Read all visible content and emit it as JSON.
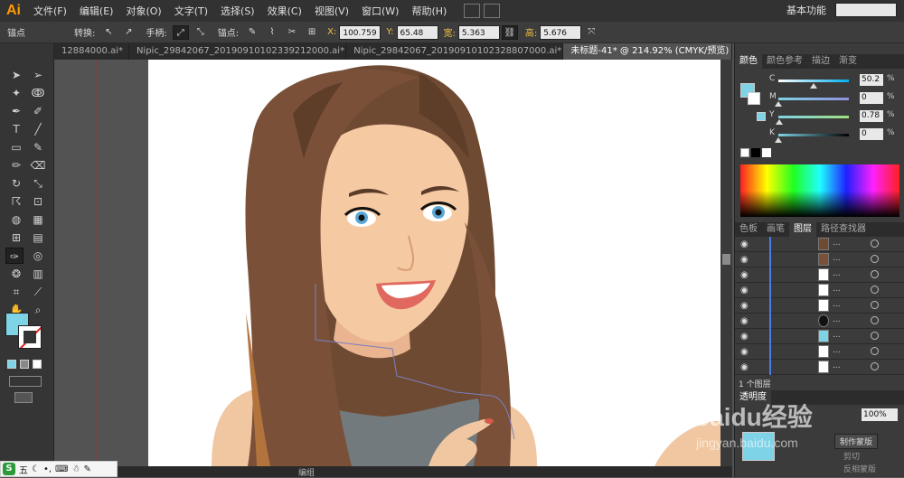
{
  "app": {
    "logo": "Ai"
  },
  "menubar": {
    "items": [
      "文件(F)",
      "编辑(E)",
      "对象(O)",
      "文字(T)",
      "选择(S)",
      "效果(C)",
      "视图(V)",
      "窗口(W)",
      "帮助(H)"
    ],
    "workspace": "基本功能"
  },
  "controlbar": {
    "mode_label": "锚点",
    "convert_label": "转换:",
    "handle_label": "手柄:",
    "anchor_label": "锚点:",
    "x_label": "X:",
    "x_value": "100.759",
    "y_label": "Y:",
    "y_value": "65.48 mm",
    "w_label": "宽:",
    "w_value": "5.363 mm",
    "h_label": "高:",
    "h_value": "5.676 mm"
  },
  "tabs": [
    {
      "label": "12884000.ai*",
      "active": false
    },
    {
      "label": "Nipic_29842067_20190910102339212000.ai*",
      "active": false
    },
    {
      "label": "Nipic_29842067_20190910102328807000.ai*",
      "active": false
    },
    {
      "label": "未标题-41* @ 214.92% (CMYK/预览)",
      "active": true
    }
  ],
  "color_panel": {
    "tabs": [
      "颜色",
      "颜色参考",
      "描边",
      "渐变"
    ],
    "channels": [
      {
        "name": "C",
        "value": "50.2",
        "unit": "%",
        "level": 0.502
      },
      {
        "name": "M",
        "value": "0",
        "unit": "%",
        "level": 0
      },
      {
        "name": "Y",
        "value": "0.78",
        "unit": "%",
        "level": 0.0078
      },
      {
        "name": "K",
        "value": "0",
        "unit": "%",
        "level": 0
      }
    ],
    "fill_color": "#7fd3e6"
  },
  "layers_panel": {
    "tabs": [
      "色板",
      "画笔",
      "图层",
      "路径查找器"
    ],
    "rows": [
      "...",
      "...",
      "...",
      "...",
      "...",
      "...",
      "...",
      "...",
      "..."
    ],
    "footer": "1 个图层"
  },
  "transparency_panel": {
    "tab": "透明度",
    "opacity": "100%",
    "make_mask": "制作蒙版",
    "clip": "剪切",
    "invert_mask": "反相蒙版"
  },
  "status": {
    "zoom_label": "编组"
  },
  "taskbar": {
    "ime": "五"
  },
  "watermark": {
    "brand": "Baidu经验",
    "url": "jingyan.baidu.com"
  }
}
